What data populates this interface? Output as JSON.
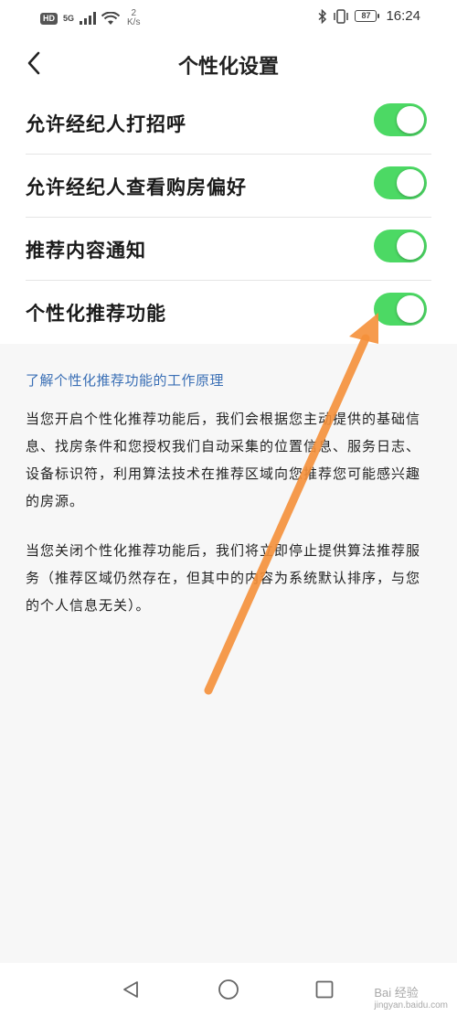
{
  "status_bar": {
    "hd_badge": "HD",
    "network": "5G",
    "speed_value": "2",
    "speed_unit": "K/s",
    "battery": "87",
    "time": "16:24",
    "icons": [
      "signal-icon",
      "wifi-icon",
      "bluetooth-icon",
      "vibrate-icon",
      "battery-icon"
    ]
  },
  "header": {
    "title": "个性化设置",
    "back_icon": "chevron-left-icon"
  },
  "settings": [
    {
      "label": "允许经纪人打招呼",
      "enabled": true
    },
    {
      "label": "允许经纪人查看购房偏好",
      "enabled": true
    },
    {
      "label": "推荐内容通知",
      "enabled": true
    },
    {
      "label": "个性化推荐功能",
      "enabled": true
    }
  ],
  "info": {
    "link": "了解个性化推荐功能的工作原理",
    "paragraph1": "当您开启个性化推荐功能后，我们会根据您主动提供的基础信息、找房条件和您授权我们自动采集的位置信息、服务日志、设备标识符，利用算法技术在推荐区域向您推荐您可能感兴趣的房源。",
    "paragraph2": "当您关闭个性化推荐功能后，我们将立即停止提供算法推荐服务（推荐区域仍然存在，但其中的内容为系统默认排序，与您的个人信息无关）。"
  },
  "navbar": {
    "icons": [
      "back-triangle-icon",
      "home-circle-icon",
      "recents-square-icon"
    ]
  },
  "watermark": {
    "text": "Bai 经验",
    "sub": "jingyan.baidu.com"
  },
  "colors": {
    "toggle_on": "#4cd964",
    "link": "#3a6fb5",
    "arrow": "#f5903a"
  }
}
